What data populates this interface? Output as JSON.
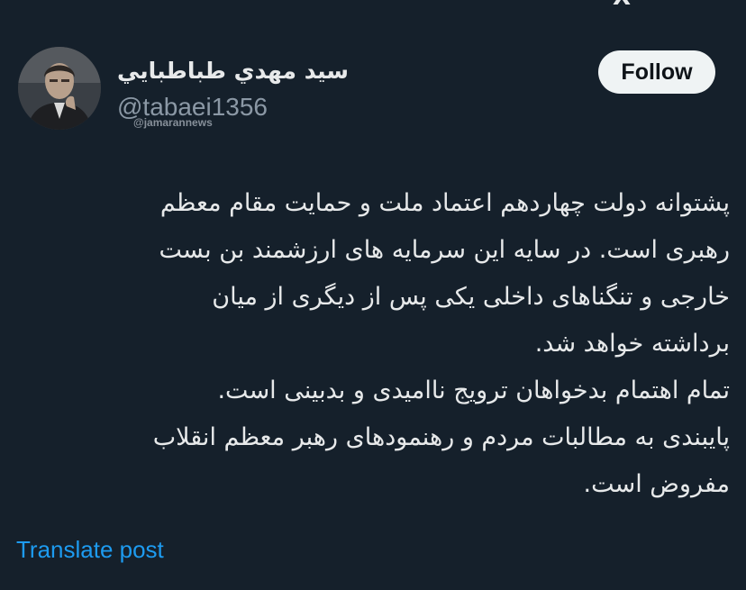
{
  "header": {
    "logo_icon": "x-logo-icon",
    "logo_text": "X"
  },
  "author": {
    "display_name": "سيد مهدي طباطبايي",
    "handle": "@tabaei1356",
    "avatar_icon": "user-avatar"
  },
  "watermark": "@jamarannews",
  "follow_button": {
    "label": "Follow"
  },
  "tweet": {
    "lines": [
      "پشتوانه دولت چهاردهم اعتماد ملت و حمایت مقام معظم",
      "رهبری است. در سایه این سرمایه های ارزشمند بن بست",
      "خارجی و تنگناهای داخلی یکی پس از دیگری از میان",
      "برداشته خواهد شد.",
      "تمام اهتمام بدخواهان ترویج ناامیدی و بدبینی است.",
      "پایبندی به مطالبات مردم و رهنمودهای رهبر معظم انقلاب",
      "مفروض است."
    ]
  },
  "translate_link": "Translate post",
  "colors": {
    "background": "#15202b",
    "text_primary": "#e7e9ea",
    "text_secondary": "#8b98a5",
    "link": "#1d9bf0",
    "button_bg": "#eff3f4",
    "button_text": "#0f1419"
  }
}
